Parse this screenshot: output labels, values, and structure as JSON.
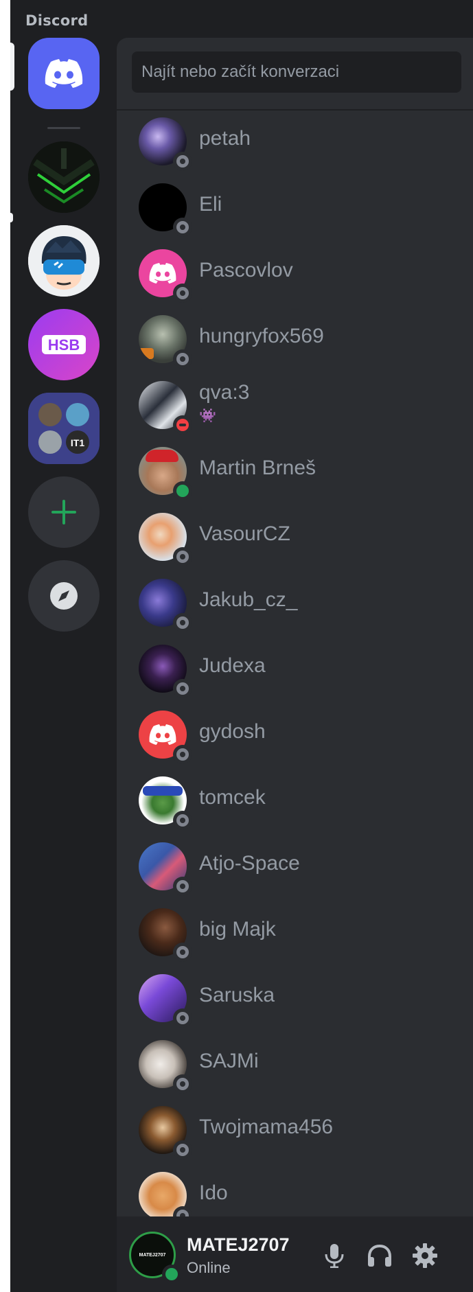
{
  "app": {
    "title": "Discord"
  },
  "search": {
    "placeholder": "Najít nebo začít konverzaci"
  },
  "servers": [
    {
      "name": "home-discord",
      "icon": "discord-logo-icon",
      "color": "#5865f2"
    },
    {
      "name": "server-green-abstract",
      "icon": "server-icon"
    },
    {
      "name": "server-vr-avatar",
      "icon": "server-icon"
    },
    {
      "name": "server-hsb",
      "icon": "server-icon",
      "label": "HSB"
    },
    {
      "name": "server-folder",
      "icon": "folder-icon"
    },
    {
      "name": "add-server",
      "icon": "plus-icon"
    },
    {
      "name": "explore-servers",
      "icon": "compass-icon"
    }
  ],
  "dms": [
    {
      "name": "petah",
      "status": "offline"
    },
    {
      "name": "Eli",
      "status": "offline"
    },
    {
      "name": "Pascovlov",
      "status": "offline"
    },
    {
      "name": "hungryfox569",
      "status": "offline"
    },
    {
      "name": "qva:3",
      "status": "dnd",
      "custom_status": "👾"
    },
    {
      "name": "Martin Brneš",
      "status": "online"
    },
    {
      "name": "VasourCZ",
      "status": "offline"
    },
    {
      "name": "Jakub_cz_",
      "status": "offline"
    },
    {
      "name": "Judexa",
      "status": "offline"
    },
    {
      "name": "gydosh",
      "status": "offline"
    },
    {
      "name": "tomcek",
      "status": "offline"
    },
    {
      "name": "Atjo-Space",
      "status": "offline"
    },
    {
      "name": "big Majk",
      "status": "offline"
    },
    {
      "name": "Saruska",
      "status": "offline"
    },
    {
      "name": "SAJMi",
      "status": "offline"
    },
    {
      "name": "Twojmama456",
      "status": "offline"
    },
    {
      "name": "Ido",
      "status": "offline"
    }
  ],
  "user": {
    "name": "MATEJ2707",
    "status": "Online",
    "avatar_text": "MATEJ2707"
  },
  "colors": {
    "accent": "#5865f2",
    "online": "#23a55a",
    "dnd": "#f23f43",
    "offline": "#80848e"
  }
}
